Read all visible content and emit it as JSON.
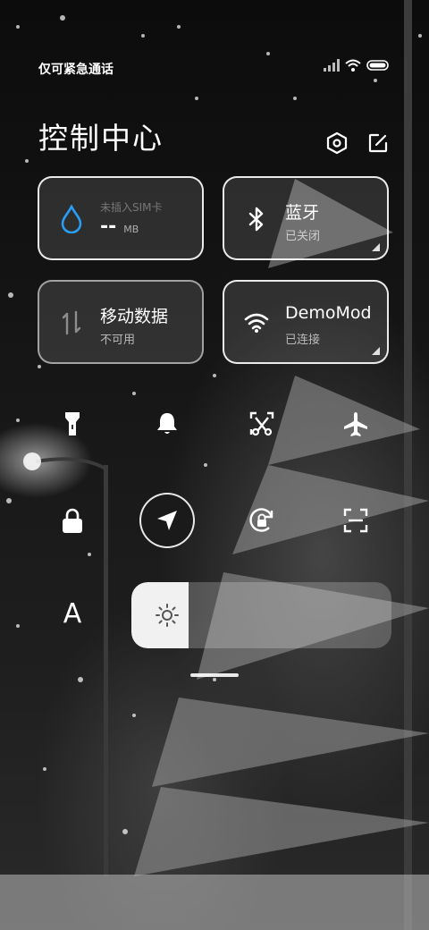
{
  "status_bar": {
    "carrier_text": "仅可紧急通话",
    "signal_icon": "signal-icon",
    "wifi_icon": "wifi-icon",
    "battery_icon": "battery-icon"
  },
  "header": {
    "title": "控制中心",
    "settings_icon": "settings-hexagon-icon",
    "edit_icon": "edit-icon"
  },
  "tiles": {
    "data_usage": {
      "title": "未插入SIM卡",
      "value": "--",
      "unit": "MB",
      "icon": "water-drop-icon"
    },
    "bluetooth": {
      "title": "蓝牙",
      "status": "已关闭",
      "icon": "bluetooth-icon"
    },
    "mobile_data": {
      "title": "移动数据",
      "status": "不可用",
      "icon": "mobile-data-icon"
    },
    "wifi": {
      "title": "DemoMod",
      "status": "已连接",
      "icon": "wifi-icon"
    }
  },
  "quick_toggles": [
    {
      "name": "flashlight",
      "icon": "flashlight-icon"
    },
    {
      "name": "mute",
      "icon": "bell-icon"
    },
    {
      "name": "screenshot",
      "icon": "screenshot-scissors-icon"
    },
    {
      "name": "airplane-mode",
      "icon": "airplane-icon"
    },
    {
      "name": "lock-screen",
      "icon": "lock-icon"
    },
    {
      "name": "location",
      "icon": "location-arrow-icon",
      "active": true
    },
    {
      "name": "rotation-lock",
      "icon": "rotation-lock-icon"
    },
    {
      "name": "scanner",
      "icon": "scan-icon"
    }
  ],
  "brightness": {
    "auto_label": "A",
    "level": 0.22,
    "icon": "sun-icon"
  },
  "colors": {
    "drop_blue": "#2a9df4",
    "slider_fill": "#f1f1f1"
  }
}
